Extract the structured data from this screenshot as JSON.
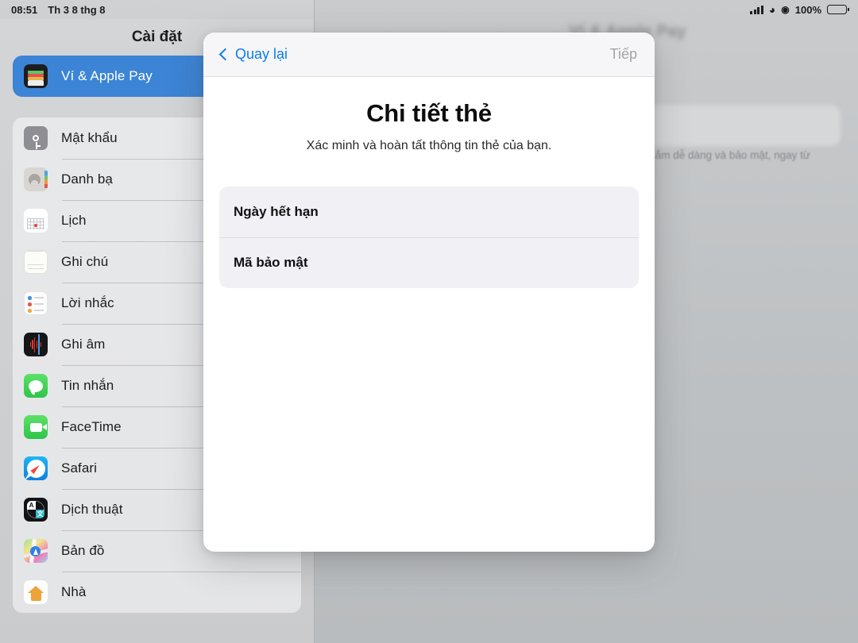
{
  "status_bar": {
    "time": "08:51",
    "date": "Th 3 8 thg 8",
    "battery_percent": "100%",
    "icons": [
      "cellular-signal-icon",
      "wifi-icon",
      "location-icon",
      "battery-icon"
    ]
  },
  "sidebar": {
    "title": "Cài đặt",
    "selected_group": [
      {
        "label": "Ví & Apple Pay",
        "icon": "wallet-icon",
        "selected": true
      }
    ],
    "items": [
      {
        "label": "Mật khẩu",
        "icon": "key-icon"
      },
      {
        "label": "Danh bạ",
        "icon": "contacts-icon"
      },
      {
        "label": "Lịch",
        "icon": "calendar-icon"
      },
      {
        "label": "Ghi chú",
        "icon": "notes-icon"
      },
      {
        "label": "Lời nhắc",
        "icon": "reminders-icon"
      },
      {
        "label": "Ghi âm",
        "icon": "voice-memos-icon"
      },
      {
        "label": "Tin nhắn",
        "icon": "messages-icon"
      },
      {
        "label": "FaceTime",
        "icon": "facetime-icon"
      },
      {
        "label": "Safari",
        "icon": "safari-icon"
      },
      {
        "label": "Dịch thuật",
        "icon": "translate-icon"
      },
      {
        "label": "Bản đồ",
        "icon": "maps-icon"
      },
      {
        "label": "Nhà",
        "icon": "home-icon"
      }
    ]
  },
  "background": {
    "title": "Ví & Apple Pay",
    "paragraph": "sắm dễ dàng và bảo mật, ngay từ"
  },
  "modal": {
    "back_label": "Quay lại",
    "next_label": "Tiếp",
    "title": "Chi tiết thẻ",
    "subtitle": "Xác minh và hoàn tất thông tin thẻ của bạn.",
    "fields": [
      {
        "label": "Ngày hết hạn",
        "value": "",
        "placeholder": ""
      },
      {
        "label": "Mã bảo mật",
        "value": "",
        "placeholder": ""
      }
    ]
  },
  "colors": {
    "accent_blue": "#0a7cf0",
    "selection_blue": "#3c84d6",
    "disabled_gray": "#a4a4a9",
    "field_bg": "#f1f1f5"
  }
}
